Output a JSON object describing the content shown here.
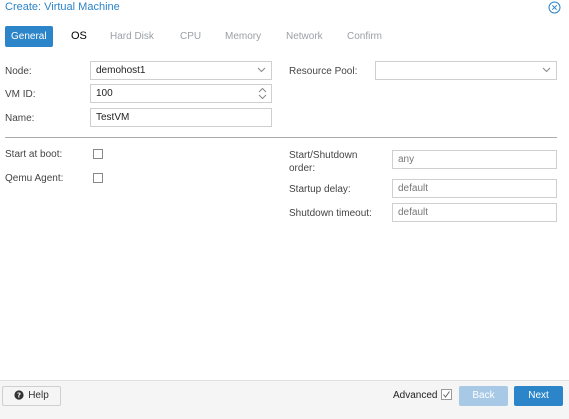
{
  "window": {
    "title": "Create: Virtual Machine"
  },
  "tabs": [
    {
      "label": "General"
    },
    {
      "label": "OS"
    },
    {
      "label": "Hard Disk"
    },
    {
      "label": "CPU"
    },
    {
      "label": "Memory"
    },
    {
      "label": "Network"
    },
    {
      "label": "Confirm"
    }
  ],
  "form": {
    "node_label": "Node:",
    "node_value": "demohost1",
    "vmid_label": "VM ID:",
    "vmid_value": "100",
    "name_label": "Name:",
    "name_value": "TestVM",
    "pool_label": "Resource Pool:",
    "pool_value": "",
    "start_boot_label": "Start at boot:",
    "start_boot_checked": false,
    "qemu_agent_label": "Qemu Agent:",
    "qemu_agent_checked": false,
    "order_label_line1": "Start/Shutdown",
    "order_label_line2": "order:",
    "order_placeholder": "any",
    "delay_label": "Startup delay:",
    "delay_placeholder": "default",
    "timeout_label": "Shutdown timeout:",
    "timeout_placeholder": "default"
  },
  "footer": {
    "help_label": "Help",
    "advanced_label": "Advanced",
    "advanced_checked": true,
    "back_label": "Back",
    "next_label": "Next"
  },
  "colors": {
    "accent": "#2c84c9",
    "disabled_button": "#a7c9e6"
  }
}
